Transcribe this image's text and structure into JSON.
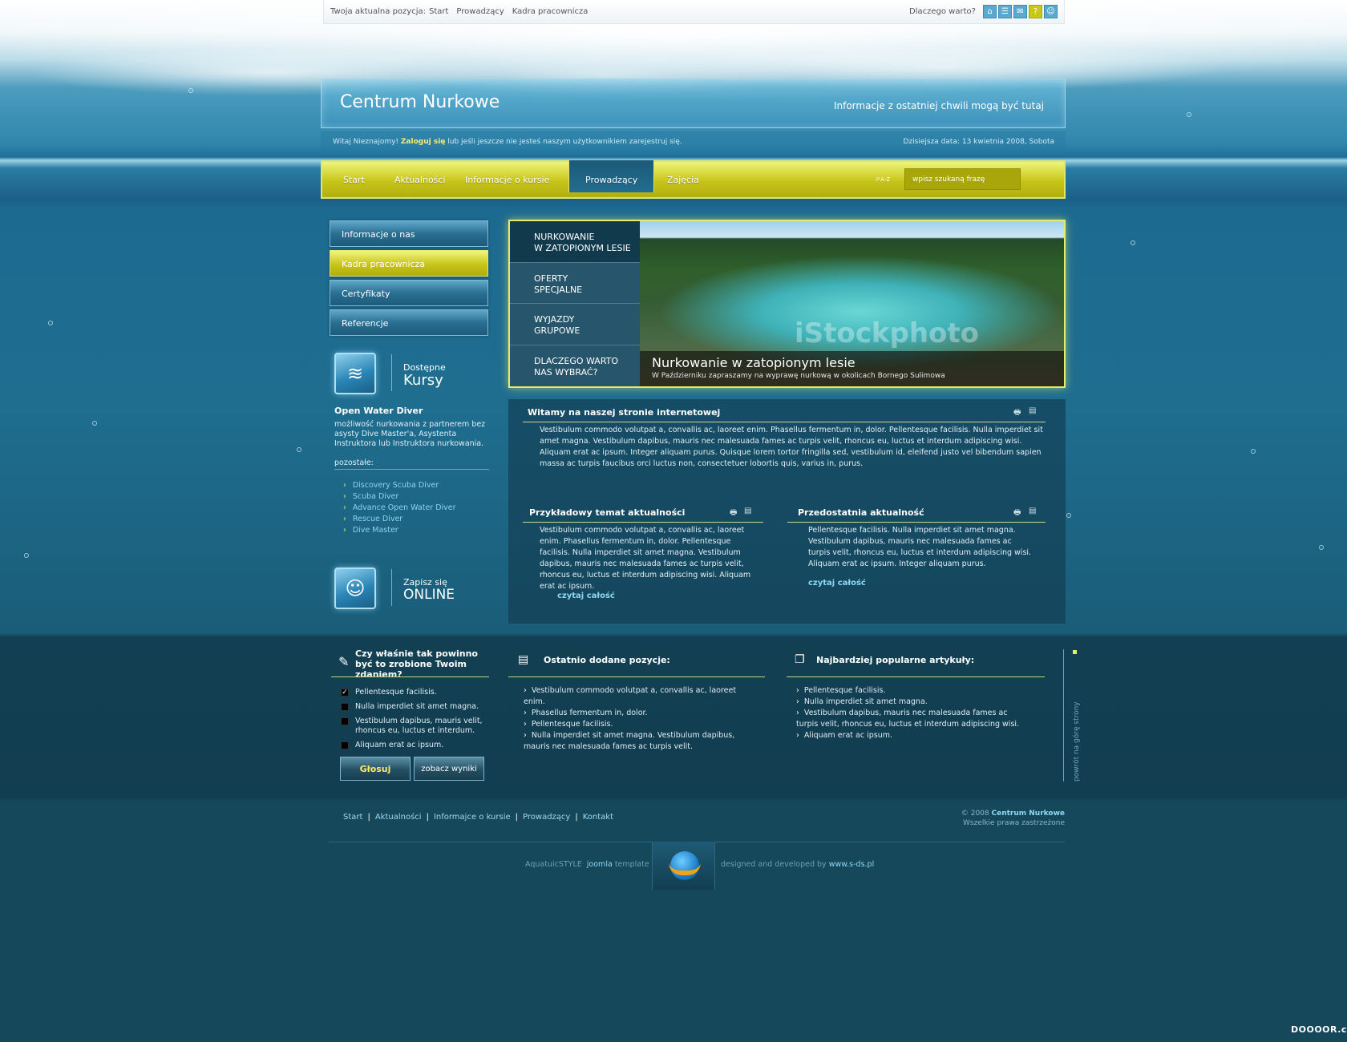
{
  "topbar": {
    "crumb_prefix": "Twoja aktualna pozycja:",
    "crumb_1": "Start",
    "crumb_2": "Prowadzący",
    "crumb_3": "Kadra pracownicza",
    "why_link": "Dlaczego warto?",
    "icons": [
      "home-icon",
      "sitemap-icon",
      "mail-icon",
      "help-icon",
      "user-icon"
    ]
  },
  "header": {
    "title": "Centrum Nurkowe",
    "tagline": "Informacje z ostatniej chwili mogą być tutaj"
  },
  "welcome": {
    "text_1": "Witaj Nieznajomy!",
    "login": "Zaloguj się",
    "text_2": "lub jeśli jeszcze nie jesteś naszym użytkownikiem zarejestruj się.",
    "date": "Dzisiejsza data: 13 kwietnia 2008, Sobota"
  },
  "nav": {
    "items": [
      "Start",
      "Aktualności",
      "Informacje o kursie",
      "Prowadzący",
      "Zajęcia"
    ],
    "active": "Prowadzący",
    "search_icon_label": "A-Z",
    "search_placeholder": "wpisz szukaną frazę"
  },
  "leftmenu": {
    "items": [
      "Informacje o nas",
      "Kadra pracownicza",
      "Certyfikaty",
      "Referencje"
    ],
    "active": "Kadra pracownicza"
  },
  "courses": {
    "heading_small": "Dostępne",
    "heading_big": "Kursy",
    "featured_title": "Open Water Diver",
    "featured_text": "możliwość nurkowania z partnerem bez asysty Dive Master'a, Asystenta Instruktora lub Instruktora nurkowania.",
    "others_label": "pozostałe:",
    "others": [
      "Discovery Scuba Diver",
      "Scuba Diver",
      "Advance Open Water Diver",
      "Rescue Diver",
      "Dive Master"
    ]
  },
  "signup": {
    "small": "Zapisz się",
    "big": "ONLINE"
  },
  "slider": {
    "tabs": [
      {
        "line1": "NURKOWANIE",
        "line2": "W ZATOPIONYM LESIE"
      },
      {
        "line1": "OFERTY",
        "line2": "SPECJALNE"
      },
      {
        "line1": "WYJAZDY",
        "line2": "GRUPOWE"
      },
      {
        "line1": "DLACZEGO WARTO",
        "line2": "NAS WYBRAĆ?"
      }
    ],
    "watermark": "iStockphoto",
    "caption_title": "Nurkowanie w zatopionym lesie",
    "caption_text": "W Październiku zapraszamy na wyprawę nurkową w okolicach Bornego Sulimowa"
  },
  "content": {
    "welcome_title": "Witamy na naszej stronie internetowej",
    "welcome_text": "Vestibulum commodo volutpat a, convallis ac, laoreet enim. Phasellus fermentum in, dolor. Pellentesque facilisis. Nulla imperdiet sit amet magna. Vestibulum dapibus, mauris nec malesuada fames ac turpis velit, rhoncus eu, luctus et interdum adipiscing wisi. Aliquam erat ac ipsum. Integer aliquam purus. Quisque lorem tortor fringilla sed, vestibulum id, eleifend justo vel bibendum sapien massa ac turpis faucibus orci luctus non, consectetuer lobortis quis, varius in, purus.",
    "news1_title": "Przykładowy temat aktualności",
    "news1_text": "Vestibulum commodo volutpat a, convallis ac, laoreet enim. Phasellus fermentum in, dolor. Pellentesque facilisis. Nulla imperdiet sit amet magna. Vestibulum dapibus, mauris nec malesuada fames ac turpis velit, rhoncus eu, luctus et interdum adipiscing wisi. Aliquam erat ac ipsum.",
    "news1_more": "czytaj całość",
    "news2_title": "Przedostatnia aktualność",
    "news2_text": "Pellentesque facilisis. Nulla imperdiet sit amet magna. Vestibulum dapibus, mauris nec malesuada fames ac turpis velit, rhoncus eu, luctus et interdum adipiscing wisi. Aliquam erat ac ipsum. Integer aliquam purus.",
    "news2_more": "czytaj całość"
  },
  "poll": {
    "question": "Czy właśnie tak powinno być to zrobione Twoim zdaniem?",
    "options": [
      {
        "label": "Pellentesque facilisis.",
        "checked": true
      },
      {
        "label": "Nulla imperdiet sit amet magna.",
        "checked": false
      },
      {
        "label": "Vestibulum dapibus, mauris velit, rhoncus eu, luctus et interdum.",
        "checked": false
      },
      {
        "label": "Aliquam erat ac ipsum.",
        "checked": false
      }
    ],
    "vote_button": "Głosuj",
    "results_button": "zobacz wyniki"
  },
  "recent": {
    "title": "Ostatnio dodane pozycje:",
    "items": [
      "Vestibulum commodo volutpat a, convallis ac, laoreet enim.",
      "Phasellus fermentum in, dolor.",
      "Pellentesque facilisis.",
      "Nulla imperdiet sit amet magna. Vestibulum dapibus, mauris nec malesuada fames ac turpis velit."
    ]
  },
  "popular": {
    "title": "Najbardziej popularne artykuły:",
    "items": [
      "Pellentesque facilisis.",
      "Nulla imperdiet sit amet magna.",
      "Vestibulum dapibus, mauris nec malesuada fames ac turpis velit, rhoncus eu, luctus et interdum adipiscing wisi.",
      "Aliquam erat ac ipsum."
    ]
  },
  "backtop": "powrót na górę strony",
  "footer": {
    "links": [
      "Start",
      "Aktualności",
      "Informajce o kursie",
      "Prowadzący",
      "Kontakt"
    ],
    "copyright_prefix": "© 2008",
    "copyright_name": "Centrum Nurkowe",
    "rights": "Wszelkie prawa zastrzeżone",
    "credit_left_1": "AquatuicSTYLE",
    "credit_left_2": "joomla",
    "credit_left_3": "template",
    "credit_right_1": "designed and developed by",
    "credit_right_2": "www.s-ds.pl"
  },
  "site_watermark": "DOOOOR.com",
  "colors": {
    "accent_yellow": "#c8c418",
    "water_blue": "#1f6e90",
    "dark_band": "#133e52",
    "link_blue": "#8ed7f2"
  }
}
